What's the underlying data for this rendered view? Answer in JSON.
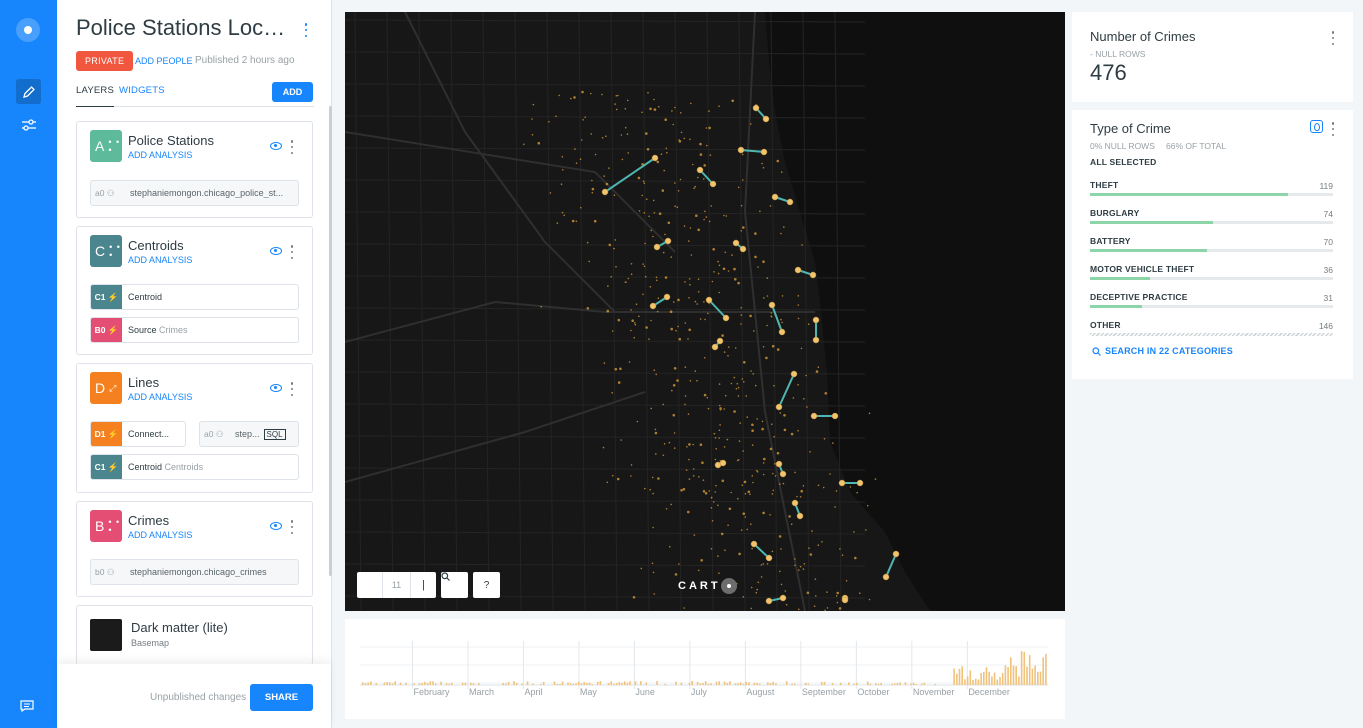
{
  "editor": {
    "title": "Police Stations Locat...",
    "privacy": "PRIVATE",
    "add_people": "ADD PEOPLE",
    "published": "Published 2 hours ago",
    "tabs": [
      "LAYERS",
      "WIDGETS"
    ],
    "add_button": "ADD",
    "unpublished": "Unpublished changes",
    "share_button": "SHARE"
  },
  "layers": [
    {
      "letter": "A",
      "name": "Police Stations",
      "action": "ADD ANALYSIS",
      "color": "#5dbb9b",
      "nodes": [
        {
          "id": "a0",
          "text": "stephaniemongon.chicago_police_st..."
        }
      ]
    },
    {
      "letter": "C",
      "name": "Centroids",
      "action": "ADD ANALYSIS",
      "color": "#4b858d",
      "nodes": [
        {
          "id": "C1",
          "text": "Centroid",
          "extra": "",
          "color": "#4b858d"
        },
        {
          "id": "B0",
          "text": "Source",
          "extra": "Crimes",
          "color": "#e44e75"
        }
      ]
    },
    {
      "letter": "D",
      "name": "Lines",
      "action": "ADD ANALYSIS",
      "color": "#f5801f",
      "nodes": [
        {
          "id": "D1",
          "text": "Connect...",
          "color": "#f5801f"
        },
        {
          "id": "a0",
          "text": "step...",
          "sql": "SQL"
        },
        {
          "id": "C1",
          "text": "Centroid",
          "extra": "Centroids",
          "color": "#4b858d"
        }
      ]
    },
    {
      "letter": "B",
      "name": "Crimes",
      "action": "ADD ANALYSIS",
      "color": "#e44e75",
      "nodes": [
        {
          "id": "b0",
          "text": "stephaniemongon.chicago_crimes"
        }
      ]
    }
  ],
  "basemap": {
    "name": "Dark matter (lite)",
    "sub": "Basemap"
  },
  "map": {
    "zoom": "11",
    "attribution": "CART",
    "search_icon": "search-icon",
    "help": "?"
  },
  "timeline": {
    "months": [
      "February",
      "March",
      "April",
      "May",
      "June",
      "July",
      "August",
      "September",
      "October",
      "November",
      "December"
    ]
  },
  "widget_count": {
    "title": "Number of Crimes",
    "sub": "- NULL ROWS",
    "value": "476"
  },
  "widget_category": {
    "title": "Type of Crime",
    "null_rows": "0% NULL ROWS",
    "of_total": "66% OF TOTAL",
    "all_selected": "ALL SELECTED",
    "search": "SEARCH IN 22 CATEGORIES",
    "max": 146,
    "categories": [
      {
        "name": "THEFT",
        "value": 119
      },
      {
        "name": "BURGLARY",
        "value": 74
      },
      {
        "name": "BATTERY",
        "value": 70
      },
      {
        "name": "MOTOR VEHICLE THEFT",
        "value": 36
      },
      {
        "name": "DECEPTIVE PRACTICE",
        "value": 31
      },
      {
        "name": "OTHER",
        "value": 146
      }
    ]
  }
}
